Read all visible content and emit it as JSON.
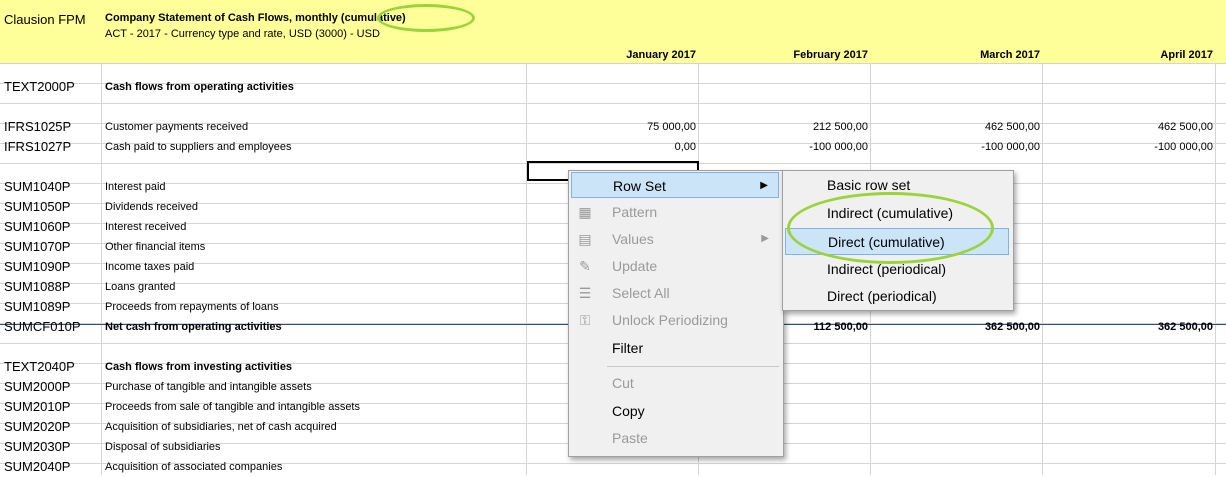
{
  "header": {
    "app": "Clausion FPM",
    "title": "Company Statement of Cash Flows, monthly",
    "title_suffix": "(cumulative)",
    "subtitle": "ACT - 2017 - Currency type and rate, USD (3000) - USD",
    "columns": [
      "January 2017",
      "February 2017",
      "March 2017",
      "April 2017"
    ]
  },
  "rows": [
    {
      "code": "TEXT2000P",
      "label": "Cash flows from operating activities",
      "bold": true
    },
    {
      "code": "IFRS1025P",
      "label": "Customer payments received",
      "values": [
        "75 000,00",
        "212 500,00",
        "462 500,00",
        "462 500,00"
      ]
    },
    {
      "code": "IFRS1027P",
      "label": "Cash paid to suppliers and employees",
      "values": [
        "0,00",
        "-100 000,00",
        "-100 000,00",
        "-100 000,00"
      ]
    },
    {
      "code": "SUM1040P",
      "label": "Interest paid"
    },
    {
      "code": "SUM1050P",
      "label": "Dividends received"
    },
    {
      "code": "SUM1060P",
      "label": "Interest received"
    },
    {
      "code": "SUM1070P",
      "label": "Other financial items"
    },
    {
      "code": "SUM1090P",
      "label": "Income taxes paid"
    },
    {
      "code": "SUM1088P",
      "label": "Loans granted"
    },
    {
      "code": "SUM1089P",
      "label": "Proceeds from repayments of loans"
    },
    {
      "code": "SUMCF010P",
      "label": "Net cash from operating activities",
      "bold": true,
      "values": [
        "",
        "112 500,00",
        "362 500,00",
        "362 500,00"
      ]
    },
    {
      "code": "TEXT2040P",
      "label": "Cash flows from investing activities",
      "bold": true
    },
    {
      "code": "SUM2000P",
      "label": "Purchase of tangible and intangible assets"
    },
    {
      "code": "SUM2010P",
      "label": "Proceeds from sale of tangible and intangible assets"
    },
    {
      "code": "SUM2020P",
      "label": "Acquisition of subsidiaries, net of cash acquired"
    },
    {
      "code": "SUM2030P",
      "label": "Disposal of subsidiaries"
    },
    {
      "code": "SUM2040P",
      "label": "Acquisition of associated companies"
    }
  ],
  "context_menu": {
    "items": [
      {
        "label": "Row Set",
        "submenu": true,
        "highlighted": true
      },
      {
        "label": "Pattern",
        "icon": "grid-icon",
        "disabled": true
      },
      {
        "label": "Values",
        "icon": "values-icon",
        "disabled": true,
        "submenu": true
      },
      {
        "label": "Update",
        "icon": "update-icon",
        "disabled": true
      },
      {
        "label": "Select All",
        "icon": "list-icon",
        "disabled": true
      },
      {
        "label": "Unlock Periodizing",
        "icon": "lock-icon",
        "disabled": true
      },
      {
        "label": "Filter"
      },
      {
        "label": "Cut",
        "disabled": true
      },
      {
        "label": "Copy"
      },
      {
        "label": "Paste",
        "disabled": true
      }
    ]
  },
  "submenu": {
    "items": [
      {
        "label": "Basic row set"
      },
      {
        "label": "Indirect (cumulative)"
      },
      {
        "label": "Direct (cumulative)",
        "highlighted": true
      },
      {
        "label": "Indirect (periodical)"
      },
      {
        "label": "Direct (periodical)"
      }
    ]
  },
  "colors": {
    "header_bg": "#ffff99",
    "annotation": "#9bd33b",
    "menu_bg": "#f0f0f0",
    "menu_highlight": "#cce4f7",
    "gridline": "#d4d4d4"
  }
}
